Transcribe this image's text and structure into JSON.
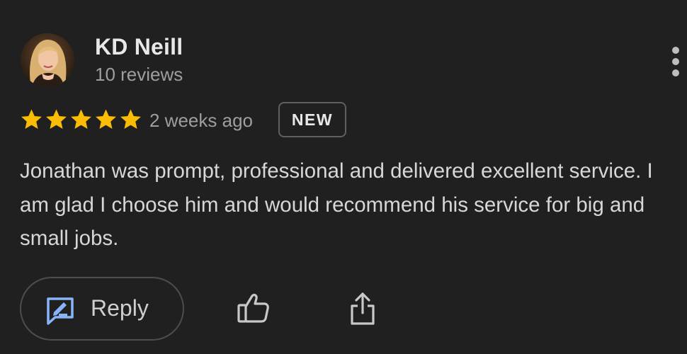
{
  "reviewer": {
    "name": "KD Neill",
    "review_count": "10 reviews",
    "avatar_icon": "profile-photo"
  },
  "menu": {
    "icon": "more-vertical-icon"
  },
  "rating": {
    "stars": 5,
    "max_stars": 5,
    "star_color": "#FBBC04",
    "time_ago": "2 weeks ago",
    "badge": "NEW"
  },
  "review": {
    "text": "Jonathan was prompt, professional and delivered excellent service. I am glad I choose him and would recommend his service for big and small jobs."
  },
  "actions": {
    "reply_label": "Reply",
    "reply_icon": "reply-icon",
    "reply_icon_color": "#8AB4F8",
    "like_icon": "thumbs-up-icon",
    "share_icon": "share-icon"
  },
  "colors": {
    "background": "#202020",
    "primary_text": "#E8E8E8",
    "secondary_text": "#9E9E9E"
  }
}
